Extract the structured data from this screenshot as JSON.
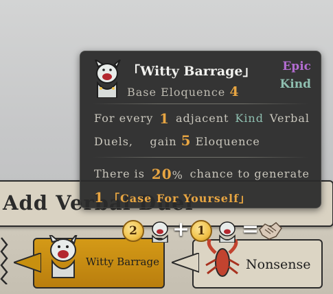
{
  "background": {
    "panel_title": "Add Verbal Duel"
  },
  "cards": [
    {
      "label": "Witty Barrage",
      "icon": "cat-face-icon",
      "color": "#c48a12"
    },
    {
      "label": "Nonsense",
      "icon": "crayfish-icon",
      "color": "#dcd5c4"
    }
  ],
  "tooltip": {
    "title": "「Witty Barrage」",
    "base_label": "Base Eloquence",
    "base_value": "4",
    "tags": [
      "Epic",
      "Kind"
    ],
    "line1": {
      "prefix": "For every",
      "count": "1",
      "mid": "adjacent",
      "kind": "Kind",
      "suffix_line1": "Verbal",
      "line2_start": "Duels,",
      "gain": "gain",
      "gain_value": "5",
      "end": "Eloquence"
    },
    "line2": {
      "prefix": "There is",
      "percent": "20",
      "percent_sign": "%",
      "suffix": "chance to generate",
      "count": "1",
      "item": "「Case For Yourself」"
    },
    "formula": {
      "coin1": "2",
      "plus": "+",
      "coin2": "1",
      "equals": "="
    }
  },
  "colors": {
    "epic": "#b36cd2",
    "kind": "#8fbfb0",
    "number": "#e7a542"
  }
}
